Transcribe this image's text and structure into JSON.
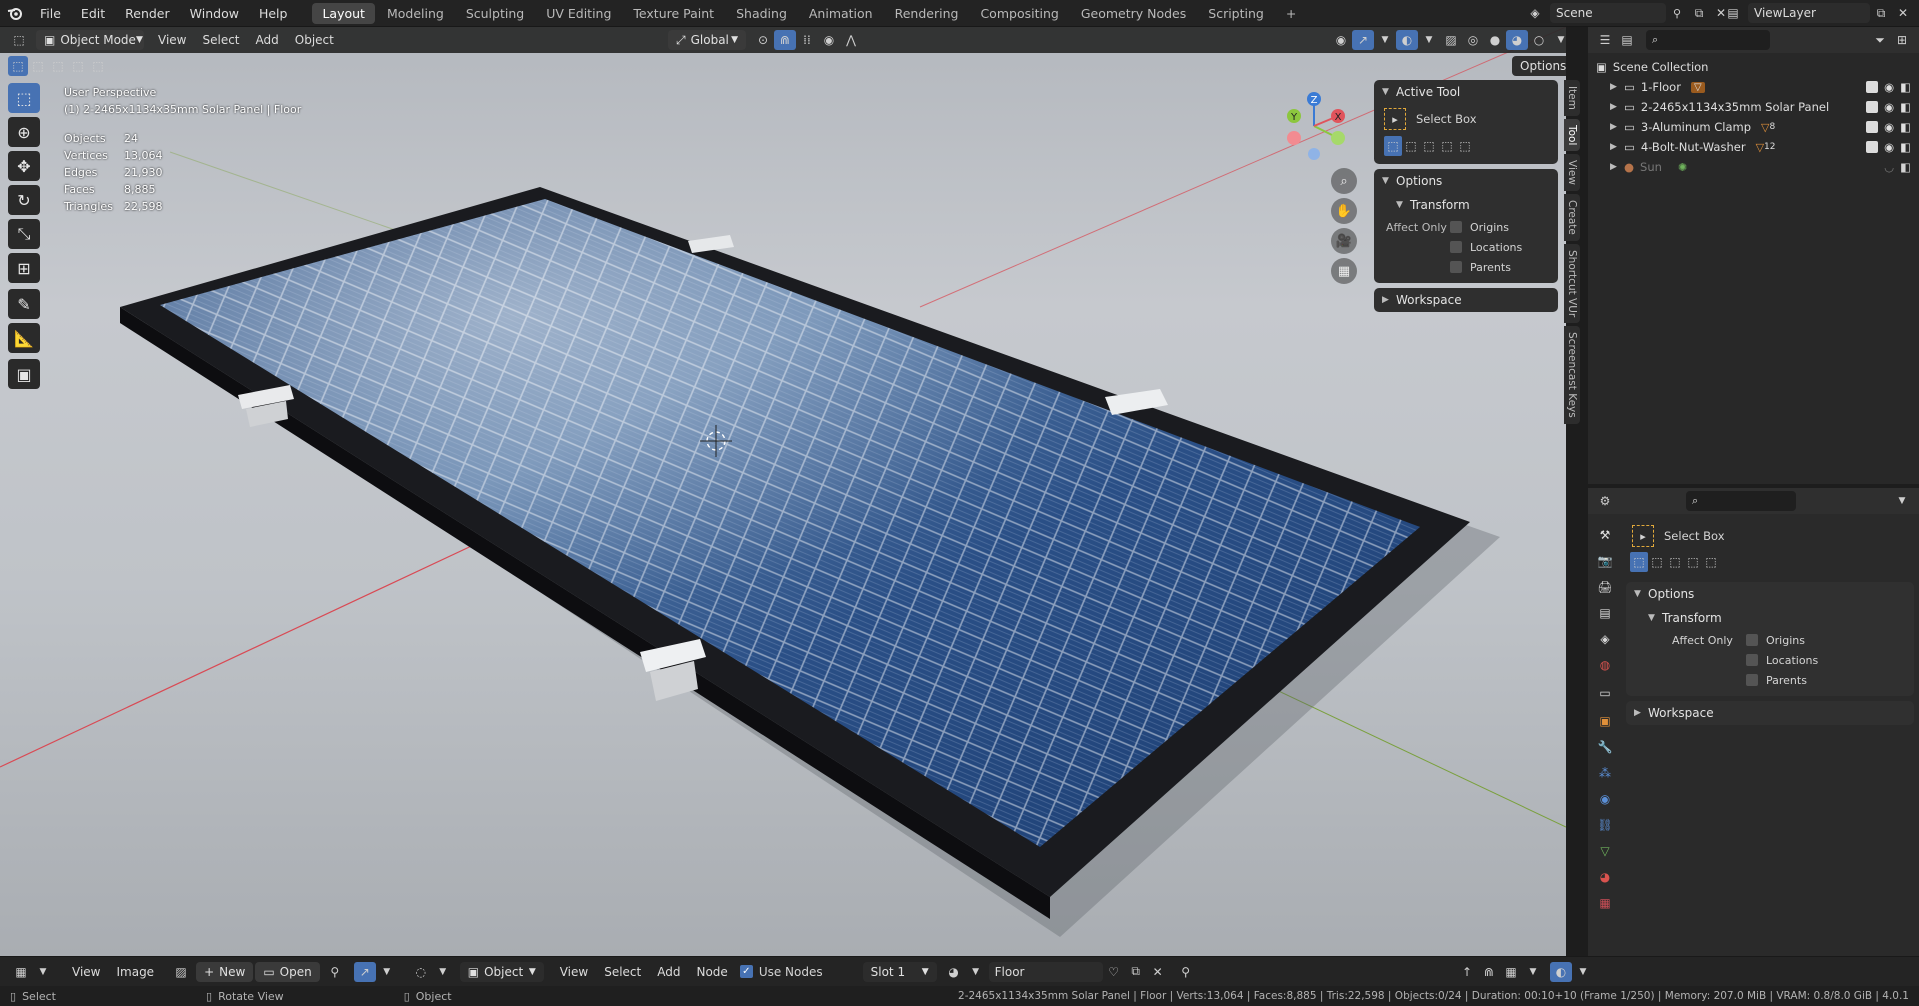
{
  "topbar": {
    "menus": [
      "File",
      "Edit",
      "Render",
      "Window",
      "Help"
    ],
    "workspaces": [
      "Layout",
      "Modeling",
      "Sculpting",
      "UV Editing",
      "Texture Paint",
      "Shading",
      "Animation",
      "Rendering",
      "Compositing",
      "Geometry Nodes",
      "Scripting"
    ],
    "active_workspace": "Layout",
    "add_tab": "+",
    "scene": "Scene",
    "view_layer": "ViewLayer"
  },
  "viewport_header": {
    "mode": "Object Mode",
    "menus": [
      "View",
      "Select",
      "Add",
      "Object"
    ],
    "orientation": "Global",
    "options": "Options"
  },
  "overlay": {
    "perspective": "User Perspective",
    "object_info": "(1) 2-2465x1134x35mm Solar Panel | Floor",
    "stats": [
      {
        "label": "Objects",
        "value": "24"
      },
      {
        "label": "Vertices",
        "value": "13,064"
      },
      {
        "label": "Edges",
        "value": "21,930"
      },
      {
        "label": "Faces",
        "value": "8,885"
      },
      {
        "label": "Triangles",
        "value": "22,598"
      }
    ]
  },
  "gizmo": {
    "z": "Z",
    "y": "Y",
    "x": "X"
  },
  "npanel": {
    "active_tool_title": "Active Tool",
    "tool_name": "Select Box",
    "options_title": "Options",
    "transform_title": "Transform",
    "affect_only": "Affect Only",
    "checks": [
      "Origins",
      "Locations",
      "Parents"
    ],
    "workspace_title": "Workspace"
  },
  "vtabs": [
    "Item",
    "Tool",
    "View",
    "Create",
    "Shortcut VUr",
    "Screencast Keys"
  ],
  "outliner": {
    "root": "Scene Collection",
    "items": [
      {
        "name": "1-Floor",
        "badge": ""
      },
      {
        "name": "2-2465x1134x35mm Solar Panel",
        "badge": ""
      },
      {
        "name": "3-Aluminum Clamp",
        "badge": "8"
      },
      {
        "name": "4-Bolt-Nut-Washer",
        "badge": "12"
      },
      {
        "name": "Sun",
        "badge": ""
      }
    ]
  },
  "properties": {
    "tool_name": "Select Box",
    "options_title": "Options",
    "transform_title": "Transform",
    "affect_only": "Affect Only",
    "checks": [
      "Origins",
      "Locations",
      "Parents"
    ],
    "workspace_title": "Workspace"
  },
  "bottom": {
    "view": "View",
    "image": "Image",
    "new": "New",
    "open": "Open",
    "object": "Object",
    "menus": [
      "View",
      "Select",
      "Add",
      "Node"
    ],
    "use_nodes": "Use Nodes",
    "slot": "Slot 1",
    "material": "Floor"
  },
  "status": {
    "select": "Select",
    "rotate": "Rotate View",
    "object": "Object",
    "info": "2-2465x1134x35mm Solar Panel | Floor | Verts:13,064 | Faces:8,885 | Tris:22,598 | Objects:0/24 | Duration: 00:10+10 (Frame 1/250) | Memory: 207.0 MiB | VRAM: 0.8/8.0 GiB | 4.0.1"
  },
  "colors": {
    "accent": "#4772b3",
    "x_axis": "#e0545c",
    "y_axis": "#8cc63e",
    "z_axis": "#3a7bd5"
  }
}
